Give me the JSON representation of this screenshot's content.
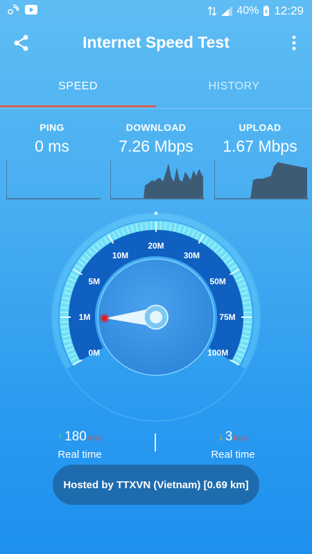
{
  "status_bar": {
    "battery": "40%",
    "time": "12:29"
  },
  "app_bar": {
    "title": "Internet Speed Test",
    "share_icon": "share-icon",
    "more_icon": "more-vert-icon"
  },
  "tabs": [
    {
      "label": "SPEED",
      "active": true
    },
    {
      "label": "HISTORY",
      "active": false
    }
  ],
  "metrics": {
    "ping": {
      "label": "PING",
      "value": "0 ms"
    },
    "download": {
      "label": "DOWNLOAD",
      "value": "7.26 Mbps"
    },
    "upload": {
      "label": "UPLOAD",
      "value": "1.67 Mbps"
    }
  },
  "gauge": {
    "tick_labels": [
      "0M",
      "1M",
      "5M",
      "10M",
      "20M",
      "30M",
      "50M",
      "75M",
      "100M"
    ],
    "needle_scale_position": 0.12
  },
  "realtime": {
    "upload": {
      "value": "180",
      "unit": "Kb/s",
      "label": "Real time"
    },
    "download": {
      "value": "3",
      "unit": "Kb/s",
      "label": "Real time"
    }
  },
  "host": {
    "text": "Hosted by TTXVN (Vietnam) [0.69 km]"
  },
  "colors": {
    "accent_tab": "#d9614f",
    "up_arrow": "#2ee87a",
    "down_arrow": "#f6a623",
    "unit_red": "#e64a3c"
  }
}
